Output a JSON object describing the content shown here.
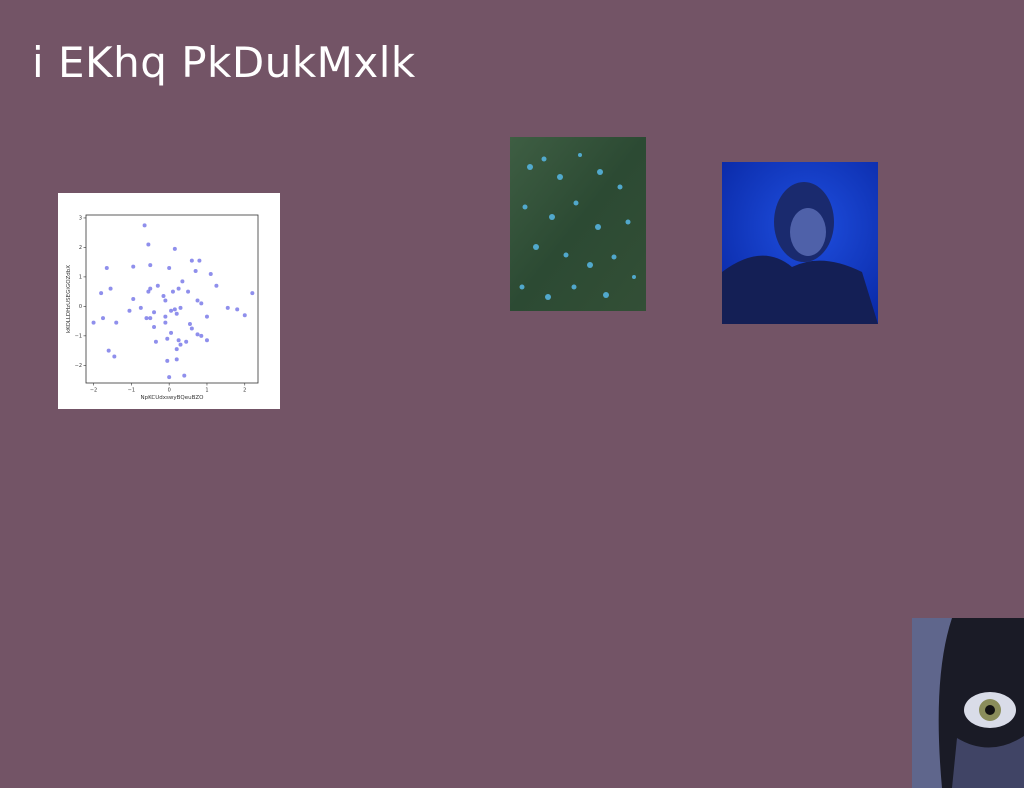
{
  "slide": {
    "title": "i EKhq PkDukMxlk",
    "background": "#735466"
  },
  "images": [
    {
      "name": "moss-with-blue-flowers-photo",
      "dominant_colors": [
        "#2f4a35",
        "#4fa9d6"
      ]
    },
    {
      "name": "blue-lit-portrait-photo",
      "dominant_colors": [
        "#0b2fb8",
        "#152266"
      ]
    },
    {
      "name": "close-up-eye-photo",
      "dominant_colors": [
        "#1c1d2a",
        "#7d86b8"
      ]
    }
  ],
  "chart_data": {
    "type": "scatter",
    "xlabel": "NpKCUdxswyBQeuBZO",
    "ylabel": "kKOLLDHzUSEGiGOZdbX",
    "xlim": [
      -2.2,
      2.35
    ],
    "ylim": [
      -2.6,
      3.1
    ],
    "xticks": [
      -2,
      -1,
      0,
      1,
      2
    ],
    "yticks": [
      -2,
      -1,
      0,
      1,
      2,
      3
    ],
    "grid": false,
    "color": "#6a6ae6",
    "points": [
      [
        -0.65,
        2.75
      ],
      [
        -0.55,
        2.1
      ],
      [
        0.15,
        1.95
      ],
      [
        0.6,
        1.55
      ],
      [
        0.8,
        1.55
      ],
      [
        -1.65,
        1.3
      ],
      [
        -0.95,
        1.35
      ],
      [
        -0.5,
        1.4
      ],
      [
        0.0,
        1.3
      ],
      [
        0.7,
        1.2
      ],
      [
        1.1,
        1.1
      ],
      [
        0.35,
        0.85
      ],
      [
        1.25,
        0.7
      ],
      [
        -1.55,
        0.6
      ],
      [
        -0.5,
        0.6
      ],
      [
        -0.55,
        0.5
      ],
      [
        -0.3,
        0.7
      ],
      [
        0.1,
        0.5
      ],
      [
        0.25,
        0.6
      ],
      [
        0.5,
        0.5
      ],
      [
        -1.8,
        0.45
      ],
      [
        -0.15,
        0.35
      ],
      [
        -0.95,
        0.25
      ],
      [
        -0.1,
        0.2
      ],
      [
        0.85,
        0.1
      ],
      [
        1.55,
        -0.05
      ],
      [
        1.8,
        -0.1
      ],
      [
        2.2,
        0.45
      ],
      [
        0.75,
        0.2
      ],
      [
        -0.75,
        -0.05
      ],
      [
        -1.05,
        -0.15
      ],
      [
        -0.4,
        -0.2
      ],
      [
        0.3,
        -0.05
      ],
      [
        0.05,
        -0.15
      ],
      [
        0.2,
        -0.25
      ],
      [
        0.15,
        -0.1
      ],
      [
        -0.1,
        -0.35
      ],
      [
        -0.6,
        -0.4
      ],
      [
        -0.5,
        -0.4
      ],
      [
        1.0,
        -0.35
      ],
      [
        2.0,
        -0.3
      ],
      [
        -1.75,
        -0.4
      ],
      [
        -1.4,
        -0.55
      ],
      [
        -2.0,
        -0.55
      ],
      [
        0.55,
        -0.6
      ],
      [
        -0.4,
        -0.7
      ],
      [
        -0.1,
        -0.55
      ],
      [
        0.05,
        -0.9
      ],
      [
        0.6,
        -0.75
      ],
      [
        0.75,
        -0.95
      ],
      [
        1.0,
        -1.15
      ],
      [
        0.85,
        -1.0
      ],
      [
        -0.05,
        -1.1
      ],
      [
        0.25,
        -1.15
      ],
      [
        0.45,
        -1.2
      ],
      [
        -0.35,
        -1.2
      ],
      [
        0.3,
        -1.3
      ],
      [
        0.2,
        -1.45
      ],
      [
        -1.6,
        -1.5
      ],
      [
        -1.45,
        -1.7
      ],
      [
        0.2,
        -1.8
      ],
      [
        -0.05,
        -1.85
      ],
      [
        0.4,
        -2.35
      ],
      [
        0.0,
        -2.4
      ]
    ]
  }
}
